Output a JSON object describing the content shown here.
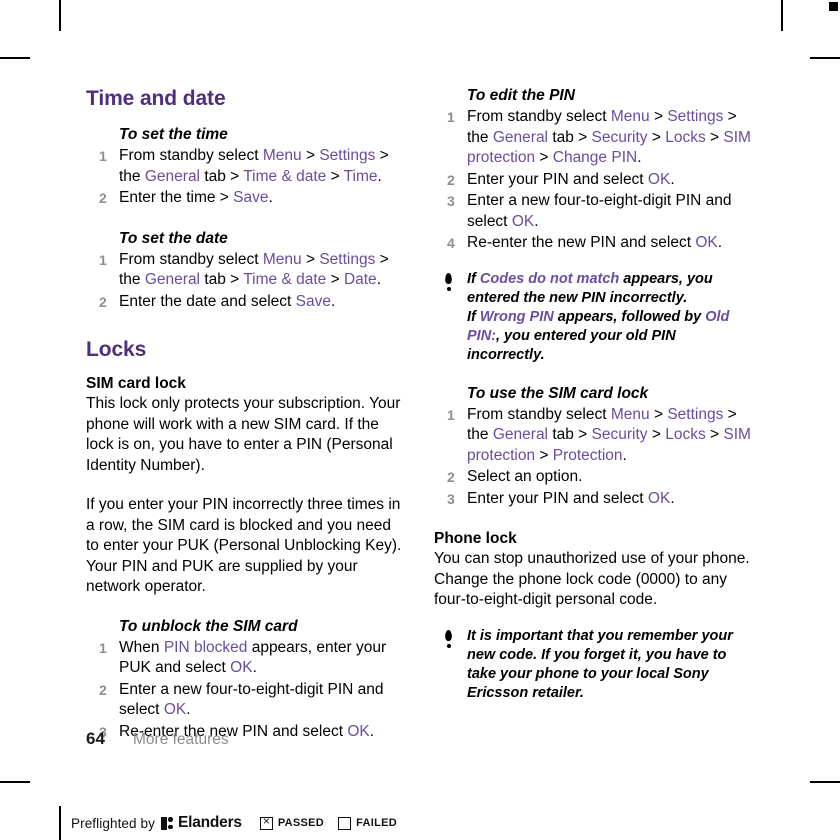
{
  "document": {
    "folio": "64",
    "running_head": "More features",
    "link_color": "#6a4d9e",
    "heading_color": "#4f2d7f",
    "step_number_color": "#8e8e8e"
  },
  "left_column": {
    "section_title": "Time and date",
    "proc_set_time": {
      "title": "To set the time",
      "steps": [
        {
          "parts": [
            {
              "t": "From standby select ",
              "k": "plain"
            },
            {
              "t": "Menu",
              "k": "link"
            },
            {
              "t": " > ",
              "k": "plain"
            },
            {
              "t": "Settings",
              "k": "link"
            },
            {
              "t": " > the ",
              "k": "plain"
            },
            {
              "t": "General",
              "k": "link"
            },
            {
              "t": " tab > ",
              "k": "plain"
            },
            {
              "t": "Time & date",
              "k": "link"
            },
            {
              "t": " > ",
              "k": "plain"
            },
            {
              "t": "Time",
              "k": "link"
            },
            {
              "t": ".",
              "k": "plain"
            }
          ]
        },
        {
          "parts": [
            {
              "t": "Enter the time > ",
              "k": "plain"
            },
            {
              "t": "Save",
              "k": "link"
            },
            {
              "t": ".",
              "k": "plain"
            }
          ]
        }
      ]
    },
    "proc_set_date": {
      "title": "To set the date",
      "steps": [
        {
          "parts": [
            {
              "t": "From standby select ",
              "k": "plain"
            },
            {
              "t": "Menu",
              "k": "link"
            },
            {
              "t": " > ",
              "k": "plain"
            },
            {
              "t": "Settings",
              "k": "link"
            },
            {
              "t": " > the ",
              "k": "plain"
            },
            {
              "t": "General",
              "k": "link"
            },
            {
              "t": " tab > ",
              "k": "plain"
            },
            {
              "t": "Time & date",
              "k": "link"
            },
            {
              "t": " > ",
              "k": "plain"
            },
            {
              "t": "Date",
              "k": "link"
            },
            {
              "t": ".",
              "k": "plain"
            }
          ]
        },
        {
          "parts": [
            {
              "t": "Enter the date and select ",
              "k": "plain"
            },
            {
              "t": "Save",
              "k": "link"
            },
            {
              "t": ".",
              "k": "plain"
            }
          ]
        }
      ]
    },
    "locks_title": "Locks",
    "sim_card_lock": {
      "heading": "SIM card lock",
      "paragraph_1": "This lock only protects your subscription. Your phone will work with a new SIM card. If the lock is on, you have to enter a PIN (Personal Identity Number).",
      "paragraph_2": "If you enter your PIN incorrectly three times in a row, the SIM card is blocked and you need to enter your PUK (Personal Unblocking Key). Your PIN and PUK are supplied by your network operator."
    },
    "proc_unblock_sim": {
      "title": "To unblock the SIM card",
      "steps": [
        {
          "parts": [
            {
              "t": "When ",
              "k": "plain"
            },
            {
              "t": "PIN blocked",
              "k": "link"
            },
            {
              "t": " appears, enter your PUK and select ",
              "k": "plain"
            },
            {
              "t": "OK",
              "k": "link"
            },
            {
              "t": ".",
              "k": "plain"
            }
          ]
        },
        {
          "parts": [
            {
              "t": "Enter a new four-to-eight-digit PIN and select ",
              "k": "plain"
            },
            {
              "t": "OK",
              "k": "link"
            },
            {
              "t": ".",
              "k": "plain"
            }
          ]
        },
        {
          "parts": [
            {
              "t": "Re-enter the new PIN and select ",
              "k": "plain"
            },
            {
              "t": "OK",
              "k": "link"
            },
            {
              "t": ".",
              "k": "plain"
            }
          ]
        }
      ]
    }
  },
  "right_column": {
    "proc_edit_pin": {
      "title": "To edit the PIN",
      "steps": [
        {
          "parts": [
            {
              "t": "From standby select ",
              "k": "plain"
            },
            {
              "t": "Menu",
              "k": "link"
            },
            {
              "t": " > ",
              "k": "plain"
            },
            {
              "t": "Settings",
              "k": "link"
            },
            {
              "t": " > the ",
              "k": "plain"
            },
            {
              "t": "General",
              "k": "link"
            },
            {
              "t": " tab > ",
              "k": "plain"
            },
            {
              "t": "Security",
              "k": "link"
            },
            {
              "t": " > ",
              "k": "plain"
            },
            {
              "t": "Locks",
              "k": "link"
            },
            {
              "t": " > ",
              "k": "plain"
            },
            {
              "t": "SIM protection",
              "k": "link"
            },
            {
              "t": " > ",
              "k": "plain"
            },
            {
              "t": "Change PIN",
              "k": "link"
            },
            {
              "t": ".",
              "k": "plain"
            }
          ]
        },
        {
          "parts": [
            {
              "t": "Enter your PIN and select ",
              "k": "plain"
            },
            {
              "t": "OK",
              "k": "link"
            },
            {
              "t": ".",
              "k": "plain"
            }
          ]
        },
        {
          "parts": [
            {
              "t": "Enter a new four-to-eight-digit PIN and select ",
              "k": "plain"
            },
            {
              "t": "OK",
              "k": "link"
            },
            {
              "t": ".",
              "k": "plain"
            }
          ]
        },
        {
          "parts": [
            {
              "t": "Re-enter the new PIN and select ",
              "k": "plain"
            },
            {
              "t": "OK",
              "k": "link"
            },
            {
              "t": ".",
              "k": "plain"
            }
          ]
        }
      ]
    },
    "note_pin": {
      "icon": "exclamation-icon",
      "parts": [
        {
          "t": "If ",
          "k": "plain"
        },
        {
          "t": "Codes do not match",
          "k": "link"
        },
        {
          "t": " appears, you entered the new PIN incorrectly.",
          "k": "plain"
        },
        {
          "t": "\n",
          "k": "break"
        },
        {
          "t": "If ",
          "k": "plain"
        },
        {
          "t": "Wrong PIN",
          "k": "link"
        },
        {
          "t": " appears, followed by ",
          "k": "plain"
        },
        {
          "t": "Old PIN:",
          "k": "link"
        },
        {
          "t": ", you entered your old PIN incorrectly.",
          "k": "plain"
        }
      ]
    },
    "proc_use_sim_lock": {
      "title": "To use the SIM card lock",
      "steps": [
        {
          "parts": [
            {
              "t": "From standby select ",
              "k": "plain"
            },
            {
              "t": "Menu",
              "k": "link"
            },
            {
              "t": " > ",
              "k": "plain"
            },
            {
              "t": "Settings",
              "k": "link"
            },
            {
              "t": " > the ",
              "k": "plain"
            },
            {
              "t": "General",
              "k": "link"
            },
            {
              "t": " tab > ",
              "k": "plain"
            },
            {
              "t": "Security",
              "k": "link"
            },
            {
              "t": " > ",
              "k": "plain"
            },
            {
              "t": "Locks",
              "k": "link"
            },
            {
              "t": " > ",
              "k": "plain"
            },
            {
              "t": "SIM protection",
              "k": "link"
            },
            {
              "t": " > ",
              "k": "plain"
            },
            {
              "t": "Protection",
              "k": "link"
            },
            {
              "t": ".",
              "k": "plain"
            }
          ]
        },
        {
          "parts": [
            {
              "t": "Select an option.",
              "k": "plain"
            }
          ]
        },
        {
          "parts": [
            {
              "t": "Enter your PIN and select ",
              "k": "plain"
            },
            {
              "t": "OK",
              "k": "link"
            },
            {
              "t": ".",
              "k": "plain"
            }
          ]
        }
      ]
    },
    "phone_lock": {
      "heading": "Phone lock",
      "paragraph": "You can stop unauthorized use of your phone. Change the phone lock code (0000) to any four-to-eight-digit personal code."
    },
    "note_phone_lock": {
      "icon": "exclamation-icon",
      "parts": [
        {
          "t": "It is important that you remember your new code. If you forget it, you have to take your phone to your local Sony Ericsson retailer.",
          "k": "plain"
        }
      ]
    }
  },
  "preflight": {
    "text": "Preflighted by",
    "brand": "Elanders",
    "passed_label": "PASSED",
    "failed_label": "FAILED",
    "passed_checked": true,
    "failed_checked": false
  }
}
